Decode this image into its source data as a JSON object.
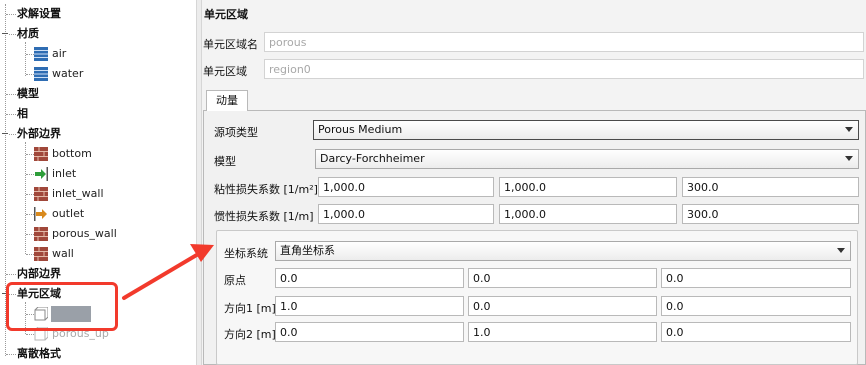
{
  "tree": {
    "solver_settings": "求解设置",
    "materials": "材质",
    "material_items": [
      "air",
      "water"
    ],
    "model": "模型",
    "phase": "相",
    "external_boundary": "外部边界",
    "boundary_items": [
      "bottom",
      "inlet",
      "inlet_wall",
      "outlet",
      "porous_wall",
      "wall"
    ],
    "internal_boundary": "内部边界",
    "cell_zone": "单元区域",
    "cell_zone_items": [
      "",
      "porous_up"
    ],
    "discretization": "离散格式"
  },
  "form": {
    "header": "单元区域",
    "zone_name_label": "单元区域名",
    "zone_name_value": "porous",
    "zone_label": "单元区域",
    "zone_value": "region0",
    "tab_momentum": "动量",
    "source_type_label": "源项类型",
    "source_type_value": "Porous Medium",
    "model_label": "模型",
    "model_value": "Darcy-Forchheimer",
    "viscous_label": "粘性损失系数 [1/m²]",
    "viscous_values": [
      "1,000.0",
      "1,000.0",
      "300.0"
    ],
    "inertial_label": "惯性损失系数 [1/m]",
    "inertial_values": [
      "1,000.0",
      "1,000.0",
      "300.0"
    ],
    "coord_label": "坐标系统",
    "coord_value": "直角坐标系",
    "origin_label": "原点",
    "origin_values": [
      "0.0",
      "0.0",
      "0.0"
    ],
    "dir1_label": "方向1 [m]",
    "dir1_values": [
      "1.0",
      "0.0",
      "0.0"
    ],
    "dir2_label": "方向2 [m]",
    "dir2_values": [
      "0.0",
      "1.0",
      "0.0"
    ]
  },
  "colors": {
    "annotation_red": "#f23a2c",
    "material_icon_blue": "#2f6db3",
    "wall_icon_brick": "#a0473a",
    "inlet_icon_green": "#2e9e3a",
    "outlet_icon_orange": "#d98a1e"
  },
  "icons": {
    "material": "material-block-icon",
    "wall": "brick-wall-icon",
    "inlet": "inlet-arrow-icon",
    "outlet": "outlet-arrow-icon",
    "zone": "cell-zone-icon"
  }
}
